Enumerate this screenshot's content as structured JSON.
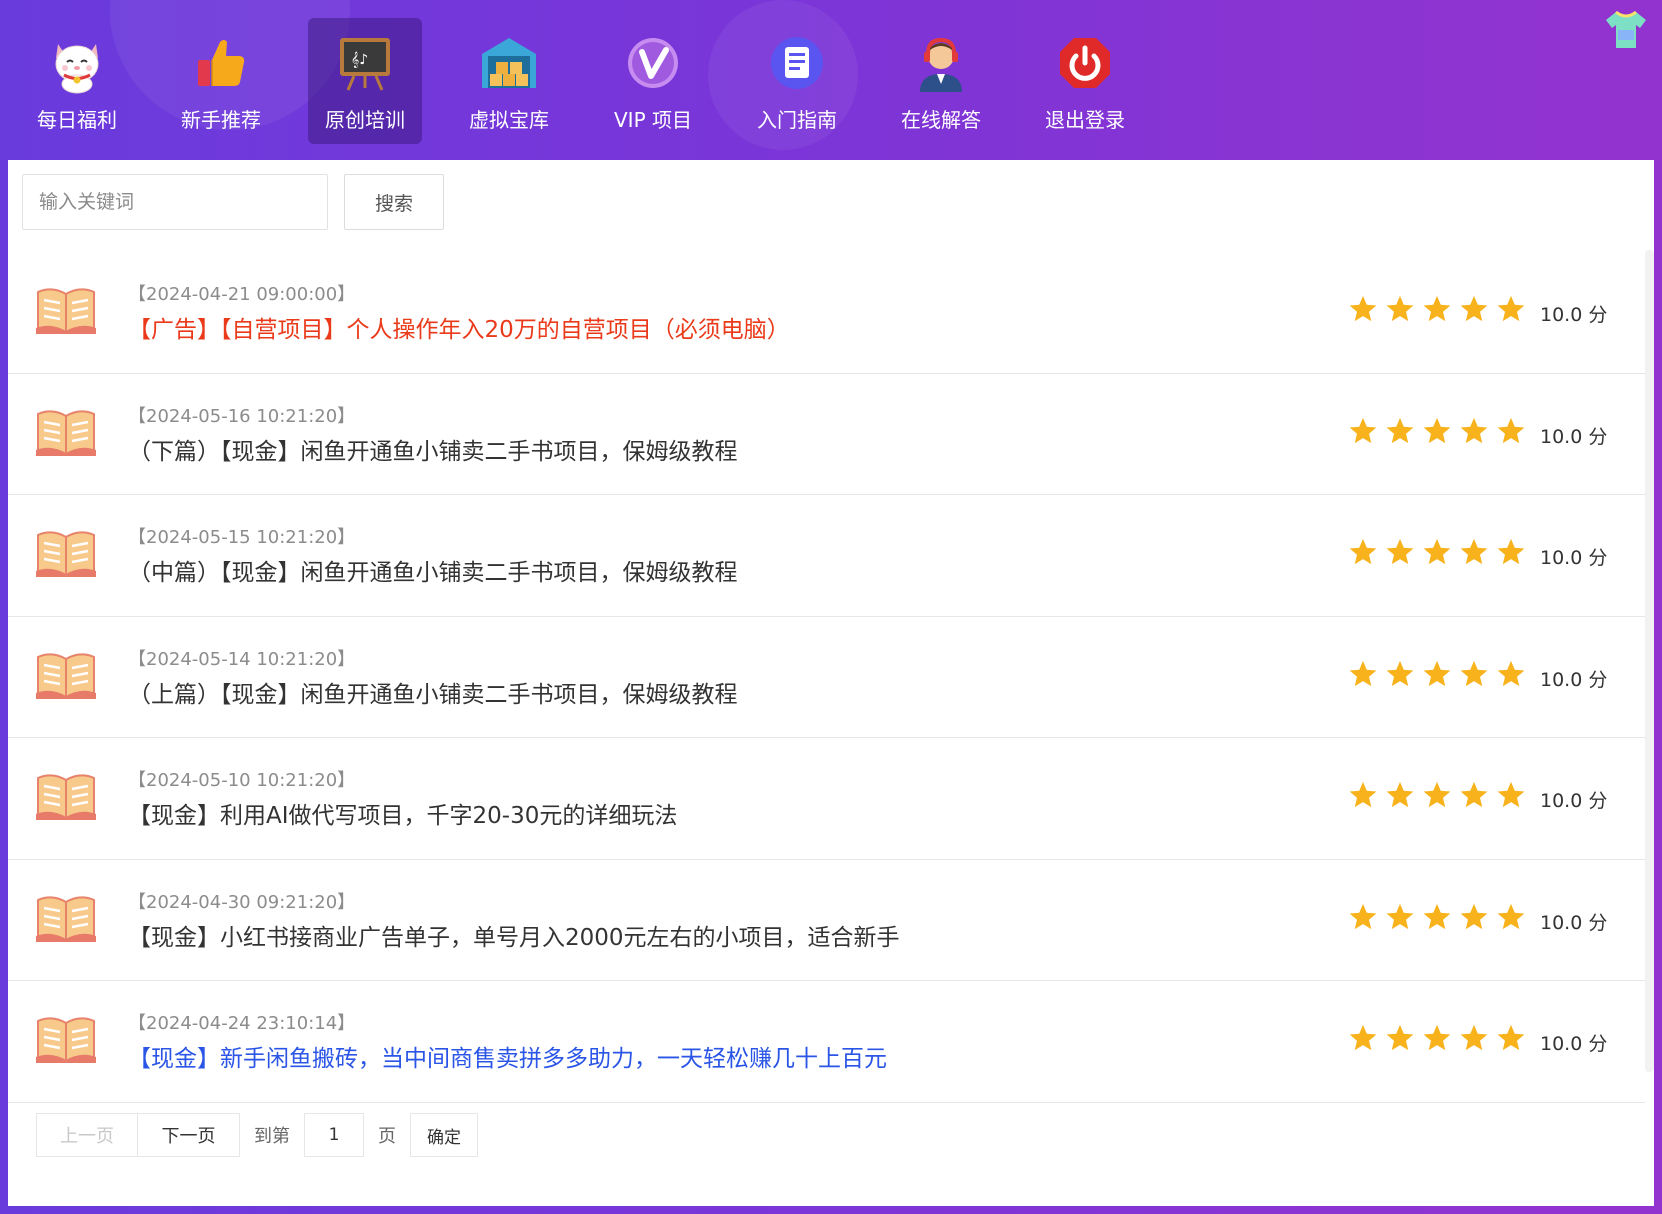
{
  "nav": {
    "items": [
      {
        "label": "每日福利",
        "icon": "lucky-cat-icon"
      },
      {
        "label": "新手推荐",
        "icon": "thumbs-up-icon"
      },
      {
        "label": "原创培训",
        "icon": "blackboard-icon",
        "active": true
      },
      {
        "label": "虚拟宝库",
        "icon": "warehouse-icon"
      },
      {
        "label": "VIP 项目",
        "icon": "vip-icon"
      },
      {
        "label": "入门指南",
        "icon": "document-icon"
      },
      {
        "label": "在线解答",
        "icon": "customer-service-icon"
      },
      {
        "label": "退出登录",
        "icon": "power-icon"
      }
    ]
  },
  "search": {
    "placeholder": "输入关键词",
    "button": "搜索"
  },
  "articles": [
    {
      "date": "【2024-04-21 09:00:00】",
      "title": "【广告】【自营项目】个人操作年入20万的自营项目（必须电脑）",
      "color": "#ea3a1a",
      "rating": 5,
      "score": "10.0 分"
    },
    {
      "date": "【2024-05-16 10:21:20】",
      "title": "（下篇）【现金】闲鱼开通鱼小铺卖二手书项目，保姆级教程",
      "color": "#333333",
      "rating": 5,
      "score": "10.0 分"
    },
    {
      "date": "【2024-05-15 10:21:20】",
      "title": "（中篇）【现金】闲鱼开通鱼小铺卖二手书项目，保姆级教程",
      "color": "#333333",
      "rating": 5,
      "score": "10.0 分"
    },
    {
      "date": "【2024-05-14 10:21:20】",
      "title": "（上篇）【现金】闲鱼开通鱼小铺卖二手书项目，保姆级教程",
      "color": "#333333",
      "rating": 5,
      "score": "10.0 分"
    },
    {
      "date": "【2024-05-10 10:21:20】",
      "title": "【现金】利用AI做代写项目，千字20-30元的详细玩法",
      "color": "#333333",
      "rating": 5,
      "score": "10.0 分"
    },
    {
      "date": "【2024-04-30 09:21:20】",
      "title": "【现金】小红书接商业广告单子，单号月入2000元左右的小项目，适合新手",
      "color": "#333333",
      "rating": 5,
      "score": "10.0 分"
    },
    {
      "date": "【2024-04-24 23:10:14】",
      "title": "【现金】新手闲鱼搬砖，当中间商售卖拼多多助力，一天轻松赚几十上百元",
      "color": "#2a55e6",
      "rating": 5,
      "score": "10.0 分"
    }
  ],
  "pager": {
    "prev": "上一页",
    "next": "下一页",
    "goto_prefix": "到第",
    "page_value": "1",
    "goto_suffix": "页",
    "confirm": "确定"
  },
  "colors": {
    "header_gradient_start": "#6a3bdc",
    "header_gradient_end": "#9333cf",
    "star": "#f7b21c",
    "ad_title": "#ea3a1a",
    "highlight_title": "#2a55e6"
  }
}
